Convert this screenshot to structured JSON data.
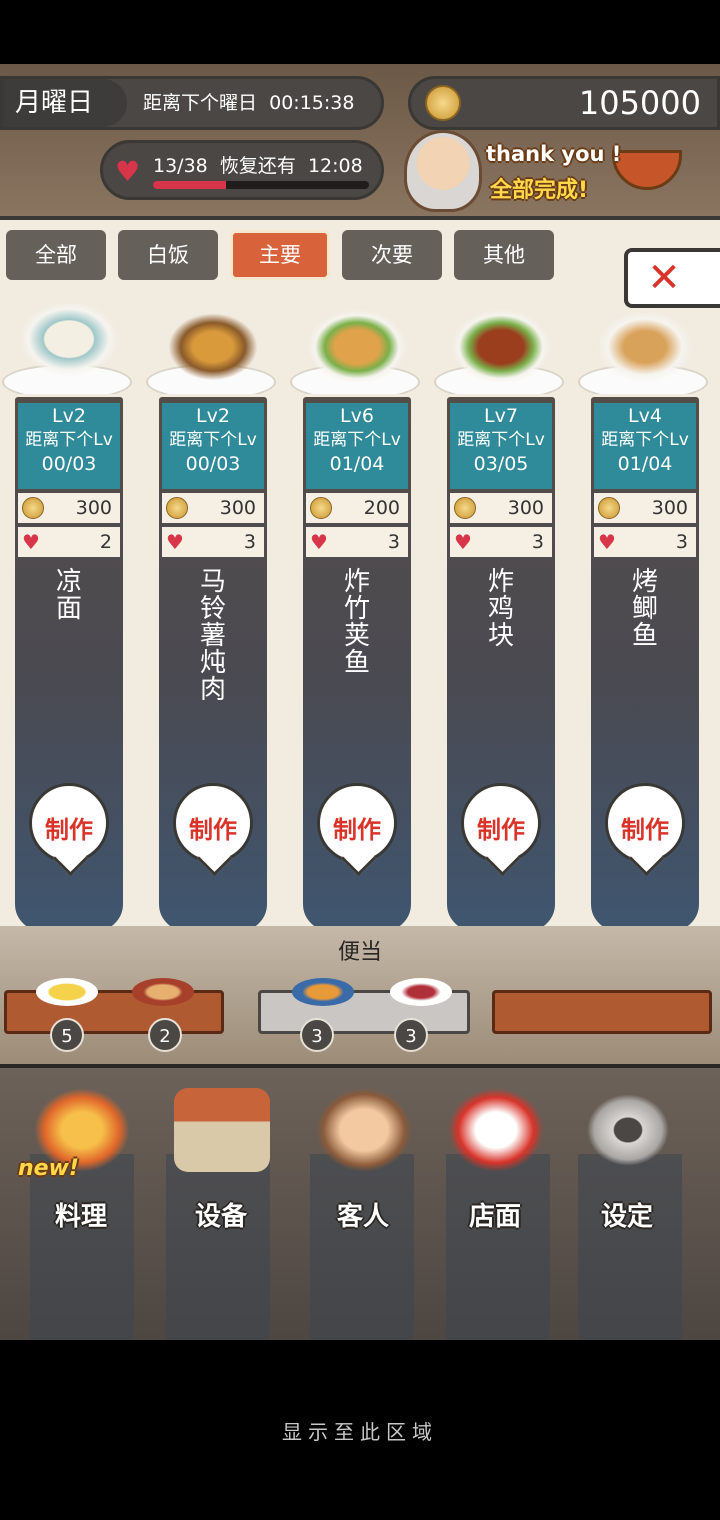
{
  "hud": {
    "day": "月曜日",
    "countdown_label": "距离下个曜日",
    "countdown_time": "00:15:38",
    "hearts": "13/38",
    "recover_label": "恢复还有",
    "recover_time": "12:08",
    "heart_fraction": 0.34,
    "coins": "105000",
    "banner_thanks": "thank  you !",
    "banner_done": "全部完成!"
  },
  "tabs": [
    "全部",
    "白饭",
    "主要",
    "次要",
    "其他"
  ],
  "active_tab": "主要",
  "close_icon": "close-icon",
  "dishes": [
    {
      "lv": "Lv2",
      "next": "距离下个Lv",
      "progress": "00/03",
      "cost": "300",
      "hearts": "2",
      "name": "凉面",
      "action": "制作"
    },
    {
      "lv": "Lv2",
      "next": "距离下个Lv",
      "progress": "00/03",
      "cost": "300",
      "hearts": "3",
      "name": "马铃薯炖肉",
      "action": "制作"
    },
    {
      "lv": "Lv6",
      "next": "距离下个Lv",
      "progress": "01/04",
      "cost": "200",
      "hearts": "3",
      "name": "炸竹荚鱼",
      "action": "制作"
    },
    {
      "lv": "Lv7",
      "next": "距离下个Lv",
      "progress": "03/05",
      "cost": "300",
      "hearts": "3",
      "name": "炸鸡块",
      "action": "制作"
    },
    {
      "lv": "Lv4",
      "next": "距离下个Lv",
      "progress": "01/04",
      "cost": "300",
      "hearts": "3",
      "name": "烤鲫鱼",
      "action": "制作"
    }
  ],
  "bento": {
    "label": "便当",
    "counts": [
      "5",
      "2",
      "3",
      "3"
    ]
  },
  "nav": [
    {
      "label": "料理",
      "tag": "new!"
    },
    {
      "label": "设备"
    },
    {
      "label": "客人"
    },
    {
      "label": "店面"
    },
    {
      "label": "设定"
    }
  ],
  "footer_hint": "显示至此区域"
}
